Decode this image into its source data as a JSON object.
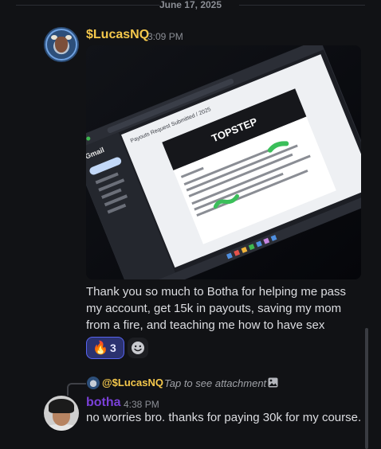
{
  "date_divider": "June 17, 2025",
  "message1": {
    "username": "$LucasNQ",
    "timestamp": "3:09 PM",
    "attachment": {
      "brand_banner": "TOPSTEP",
      "app_name": "Gmail",
      "email_subject": "Payouts Request Submitted / 2025"
    },
    "text": "Thank you so much to Botha for helping me pass my account, get 15k in payouts, saving my mom from a fire, and teaching me how to have sex",
    "reaction": {
      "emoji": "🔥",
      "count": "3"
    }
  },
  "reply": {
    "username": "@$LucasNQ",
    "snippet": "Tap to see attachment"
  },
  "message2": {
    "username": "botha",
    "timestamp": "4:38 PM",
    "text": "no worries bro. thanks for paying 30k for my course."
  },
  "colors": {
    "background": "#111215",
    "username1": "#f5c84c",
    "username2": "#7a40d8",
    "reaction_bg": "#2b3270",
    "reaction_border": "#5865f2"
  }
}
